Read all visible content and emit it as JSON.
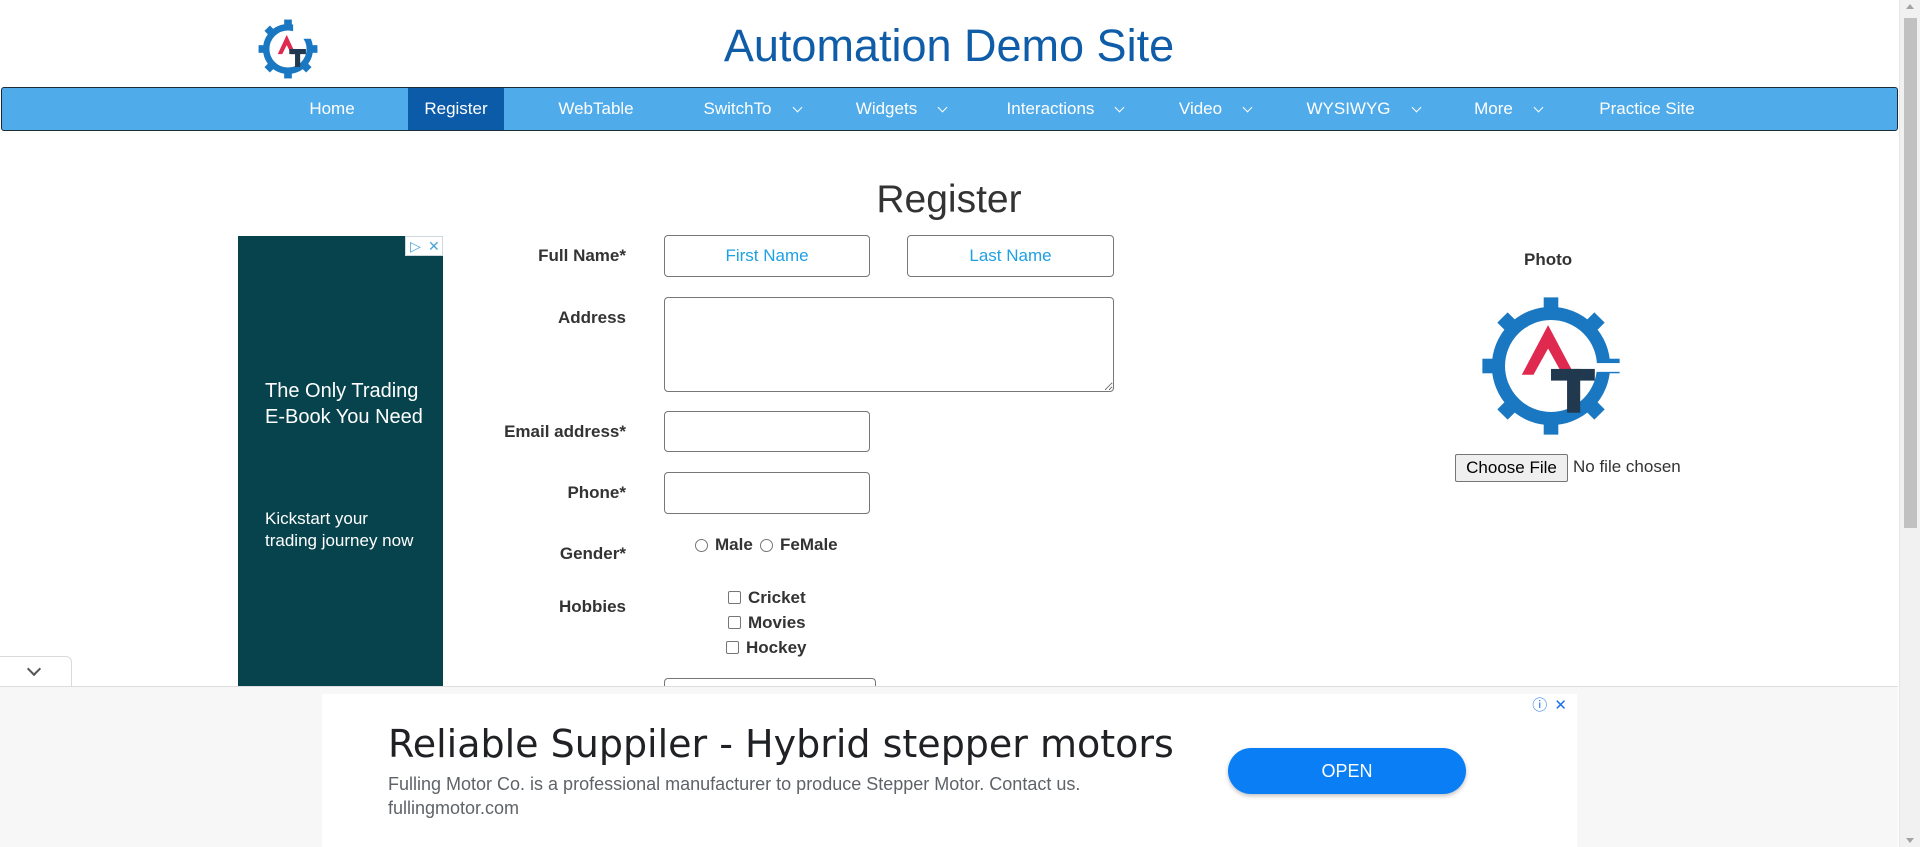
{
  "header": {
    "title": "Automation Demo Site",
    "logo_text": "AT"
  },
  "nav": {
    "items": [
      {
        "label": "Home",
        "has_dropdown": false,
        "active": false
      },
      {
        "label": "Register",
        "has_dropdown": false,
        "active": true
      },
      {
        "label": "WebTable",
        "has_dropdown": false,
        "active": false
      },
      {
        "label": "SwitchTo",
        "has_dropdown": true,
        "active": false
      },
      {
        "label": "Widgets",
        "has_dropdown": true,
        "active": false
      },
      {
        "label": "Interactions",
        "has_dropdown": true,
        "active": false
      },
      {
        "label": "Video",
        "has_dropdown": true,
        "active": false
      },
      {
        "label": "WYSIWYG",
        "has_dropdown": true,
        "active": false
      },
      {
        "label": "More",
        "has_dropdown": true,
        "active": false
      },
      {
        "label": "Practice Site",
        "has_dropdown": false,
        "active": false
      }
    ]
  },
  "page": {
    "heading": "Register"
  },
  "form": {
    "full_name_label": "Full Name*",
    "first_name_placeholder": "First Name",
    "last_name_placeholder": "Last Name",
    "address_label": "Address",
    "email_label": "Email address*",
    "phone_label": "Phone*",
    "gender_label": "Gender*",
    "gender_options": [
      "Male",
      "FeMale"
    ],
    "hobbies_label": "Hobbies",
    "hobby_options": [
      "Cricket",
      "Movies",
      "Hockey"
    ]
  },
  "photo": {
    "label": "Photo",
    "choose_file_label": "Choose File",
    "file_status": "No file chosen"
  },
  "ads": {
    "left": {
      "headline": "The Only Trading E-Book You Need",
      "body": "Kickstart your trading journey now"
    },
    "bottom": {
      "title": "Reliable Suppiler - Hybrid stepper motors",
      "description": "Fulling Motor Co. is a professional manufacturer to produce Stepper Motor. Contact us.",
      "domain": "fullingmotor.com",
      "cta": "OPEN"
    }
  },
  "colors": {
    "nav_bg": "#4fabea",
    "nav_active": "#0c5ba8",
    "title": "#0f5ca8",
    "ad_left_bg": "#07434d",
    "cta_bg": "#0a7ff5",
    "logo_gear": "#1a78c2",
    "logo_a": "#e0294f",
    "logo_t": "#20394f"
  }
}
